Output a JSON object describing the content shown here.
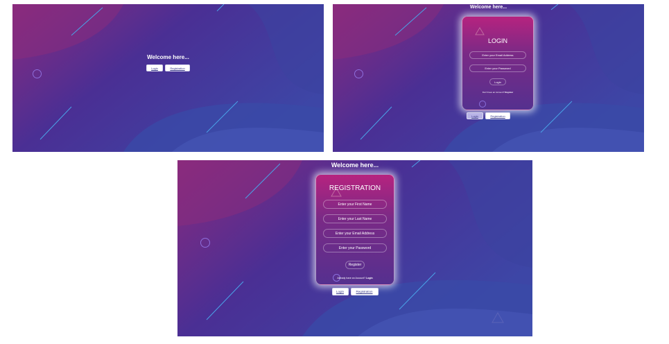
{
  "welcome": "Welcome here...",
  "nav": {
    "login_label": "Login",
    "registration_label": "Registration"
  },
  "login_card": {
    "title": "LOGIN",
    "email_placeholder": "Enter your Email Address",
    "password_placeholder": "Enter your Password",
    "submit_label": "Login",
    "footer_text": "Don't have an Account?",
    "footer_link": "Register"
  },
  "registration_card": {
    "title": "REGISTRATION",
    "first_name_placeholder": "Enter your First Name",
    "last_name_placeholder": "Enter your Last Name",
    "email_placeholder": "Enter your Email Address",
    "password_placeholder": "Enter your Password",
    "submit_label": "Register",
    "footer_text": "Already have an Account?",
    "footer_link": "Login"
  }
}
